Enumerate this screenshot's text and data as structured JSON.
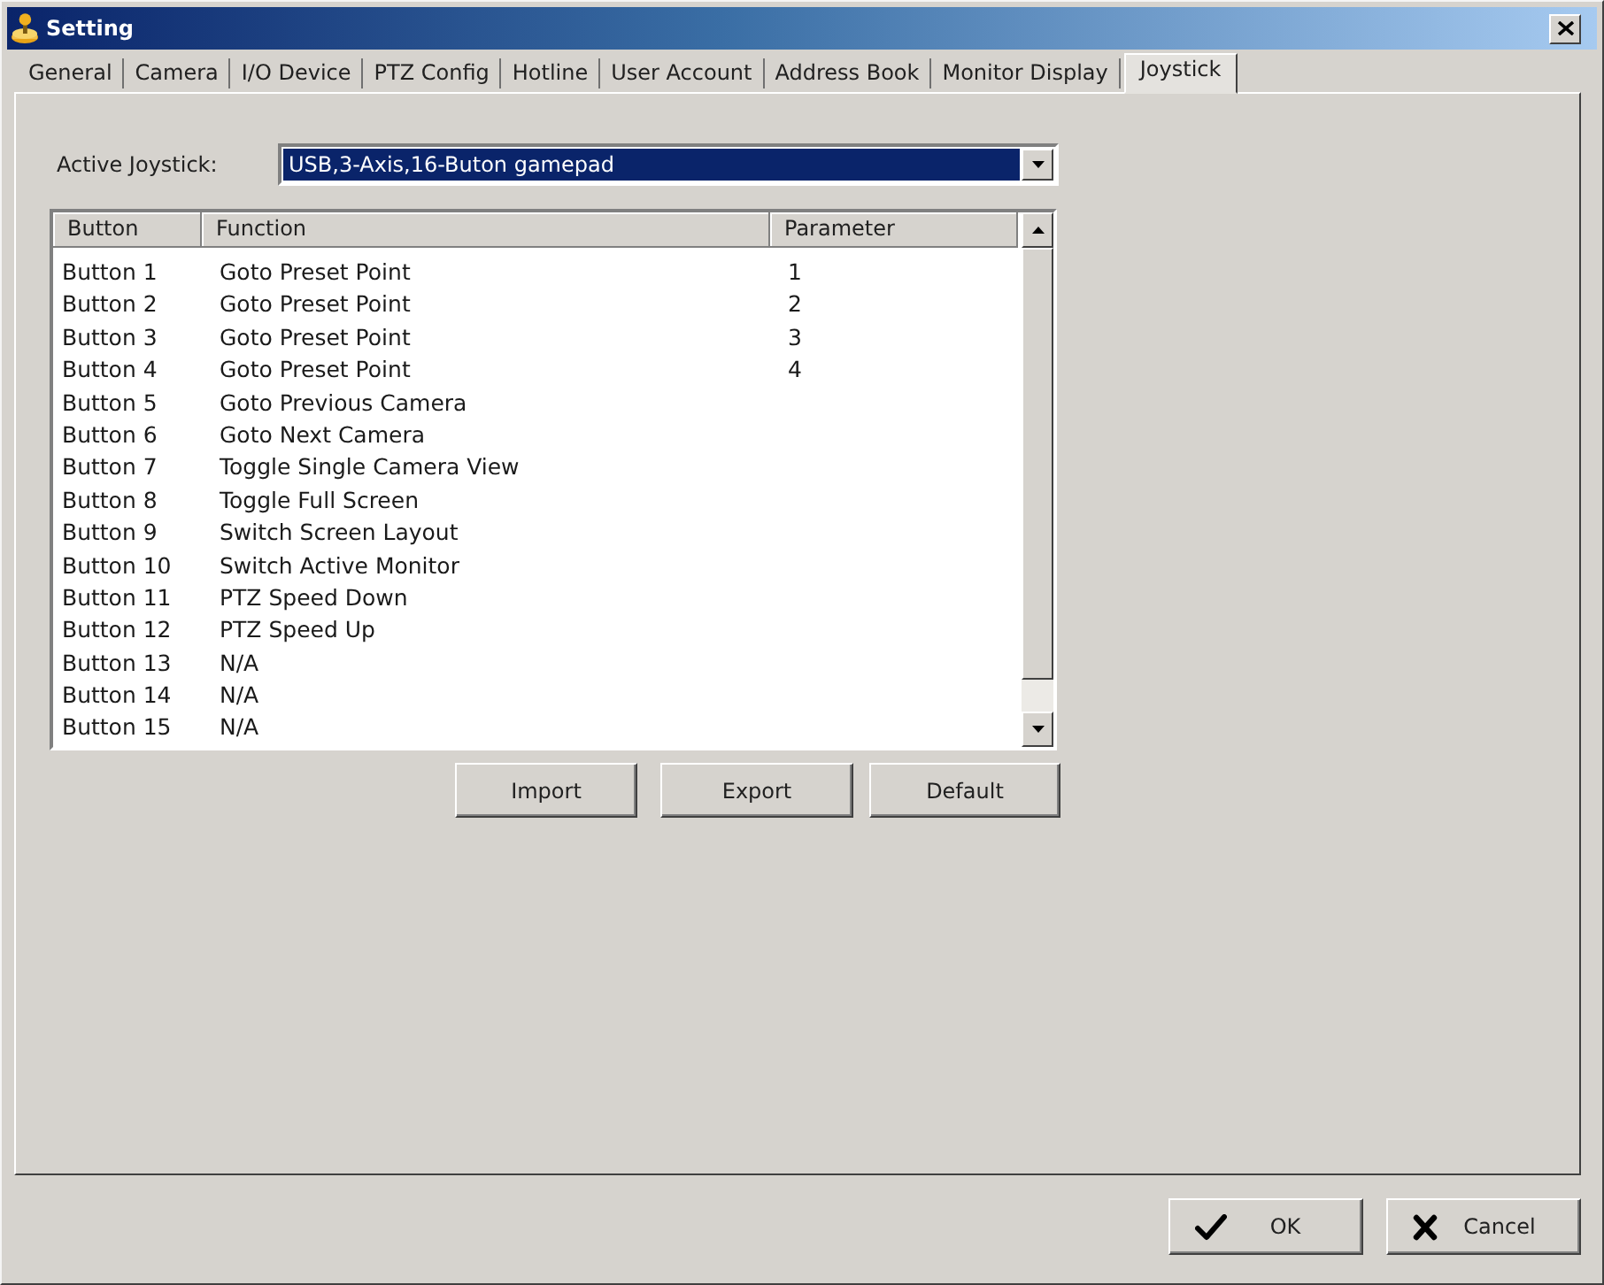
{
  "window": {
    "title": "Setting"
  },
  "tabs": [
    {
      "label": "General",
      "selected": false
    },
    {
      "label": "Camera",
      "selected": false
    },
    {
      "label": "I/O Device",
      "selected": false
    },
    {
      "label": "PTZ Config",
      "selected": false
    },
    {
      "label": "Hotline",
      "selected": false
    },
    {
      "label": "User Account",
      "selected": false
    },
    {
      "label": "Address Book",
      "selected": false
    },
    {
      "label": "Monitor Display",
      "selected": false
    },
    {
      "label": "Joystick",
      "selected": true
    }
  ],
  "active_joystick": {
    "label": "Active Joystick:",
    "value": "USB,3-Axis,16-Buton gamepad",
    "highlighted": true
  },
  "table": {
    "columns": [
      "Button",
      "Function",
      "Parameter"
    ],
    "rows": [
      [
        "Button 1",
        "Goto Preset Point",
        "1"
      ],
      [
        "Button 2",
        "Goto Preset Point",
        "2"
      ],
      [
        "Button 3",
        "Goto Preset Point",
        "3"
      ],
      [
        "Button 4",
        "Goto Preset Point",
        "4"
      ],
      [
        "Button 5",
        "Goto Previous Camera"
      ],
      [
        "Button 6",
        "Goto Next Camera"
      ],
      [
        "Button 7",
        "Toggle Single Camera View"
      ],
      [
        "Button 8",
        "Toggle Full Screen"
      ],
      [
        "Button 9",
        "Switch Screen Layout"
      ],
      [
        "Button 10",
        "Switch Active Monitor"
      ],
      [
        "Button 11",
        "PTZ Speed Down"
      ],
      [
        "Button 12",
        "PTZ Speed Up"
      ],
      [
        "Button 13",
        "N/A"
      ],
      [
        "Button 14",
        "N/A"
      ],
      [
        "Button 15",
        "N/A"
      ]
    ]
  },
  "panel_buttons": [
    "Import",
    "Export",
    "Default"
  ],
  "footer_buttons": [
    {
      "kind": "ok",
      "label": "OK"
    },
    {
      "kind": "cancel",
      "label": "Cancel"
    }
  ]
}
